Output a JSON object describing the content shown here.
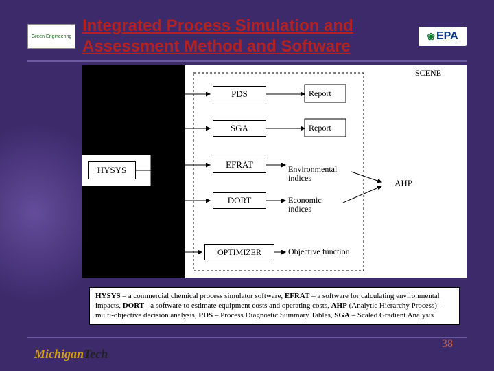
{
  "title": "Integrated Process Simulation and Assessment Method and Software",
  "logos": {
    "left_alt": "Green Engineering",
    "right_text": "EPA"
  },
  "diagram": {
    "root": "HYSYS",
    "scene_label": "SCENE",
    "nodes": {
      "pds": "PDS",
      "sga": "SGA",
      "efrat": "EFRAT",
      "dort": "DORT",
      "optimizer": "OPTIMIZER",
      "ahp": "AHP"
    },
    "outputs": {
      "report1": "Report",
      "report2": "Report",
      "env": "Environmental indices",
      "econ": "Economic indices",
      "obj": "Objective function"
    }
  },
  "caption_parts": {
    "p1a": "HYSYS",
    "p1b": " – a commercial chemical process simulator software, ",
    "p2a": "EFRAT",
    "p2b": " – a software for calculating environmental impacts, ",
    "p3a": "DORT",
    "p3b": " - a software to estimate equipment costs and operating costs, ",
    "p4a": "AHP",
    "p4b": " (Analytic Hierarchy Process) – multi-objective decision analysis, ",
    "p5a": "PDS",
    "p5b": " – Process Diagnostic Summary Tables, ",
    "p6a": "SGA",
    "p6b": " – Scaled Gradient Analysis"
  },
  "footer": {
    "uni_m": "Michigan",
    "uni_t": "Tech",
    "page": "38"
  }
}
